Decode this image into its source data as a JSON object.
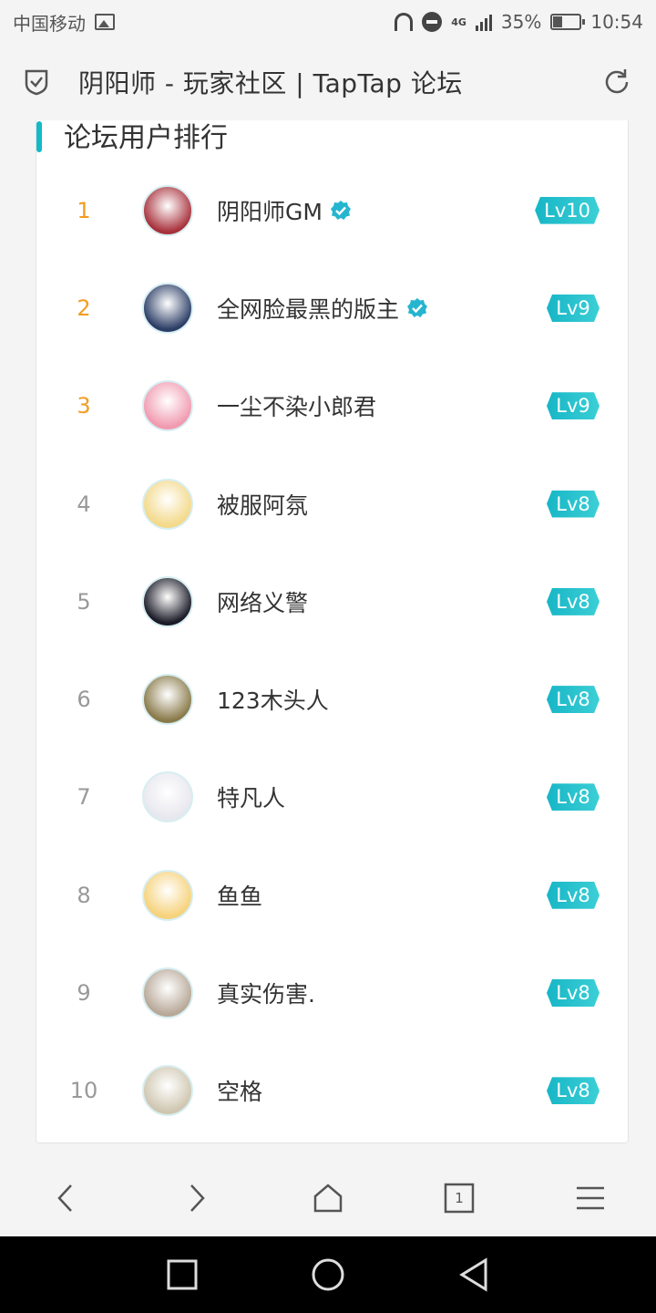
{
  "status_bar": {
    "carrier": "中国移动",
    "network": "4G",
    "battery": "35%",
    "time": "10:54"
  },
  "title_bar": {
    "title": "阴阳师 - 玩家社区 | TapTap 论坛",
    "icons": [
      "shield-check-icon",
      "refresh-icon"
    ]
  },
  "ranking": {
    "title": "论坛用户排行",
    "users": [
      {
        "rank": "1",
        "name": "阴阳师GM",
        "level": "Lv10",
        "verified": true,
        "avatar_color": "#a8323c"
      },
      {
        "rank": "2",
        "name": "全网脸最黑的版主",
        "level": "Lv9",
        "verified": true,
        "avatar_color": "#2c3e66"
      },
      {
        "rank": "3",
        "name": "一尘不染小郎君",
        "level": "Lv9",
        "verified": false,
        "avatar_color": "#f19ab0"
      },
      {
        "rank": "4",
        "name": "被服阿氛",
        "level": "Lv8",
        "verified": false,
        "avatar_color": "#f3d98a"
      },
      {
        "rank": "5",
        "name": "网络义警",
        "level": "Lv8",
        "verified": false,
        "avatar_color": "#1b1b28"
      },
      {
        "rank": "6",
        "name": "123木头人",
        "level": "Lv8",
        "verified": false,
        "avatar_color": "#8a7a4a"
      },
      {
        "rank": "7",
        "name": "特凡人",
        "level": "Lv8",
        "verified": false,
        "avatar_color": "#e7e7ee"
      },
      {
        "rank": "8",
        "name": "鱼鱼",
        "level": "Lv8",
        "verified": false,
        "avatar_color": "#f6d27a"
      },
      {
        "rank": "9",
        "name": "真实伤害.",
        "level": "Lv8",
        "verified": false,
        "avatar_color": "#b8a898"
      },
      {
        "rank": "10",
        "name": "空格",
        "level": "Lv8",
        "verified": false,
        "avatar_color": "#cfc6b0"
      }
    ]
  },
  "browser_toolbar": {
    "tab_count": "1",
    "icons": [
      "back-icon",
      "forward-icon",
      "home-icon",
      "tabs-icon",
      "menu-icon"
    ]
  },
  "system_nav": {
    "icons": [
      "recents-icon",
      "home-circle-icon",
      "back-triangle-icon"
    ]
  },
  "colors": {
    "accent": "#14b9c8",
    "top_rank": "#f39c21",
    "rank": "#999999"
  }
}
